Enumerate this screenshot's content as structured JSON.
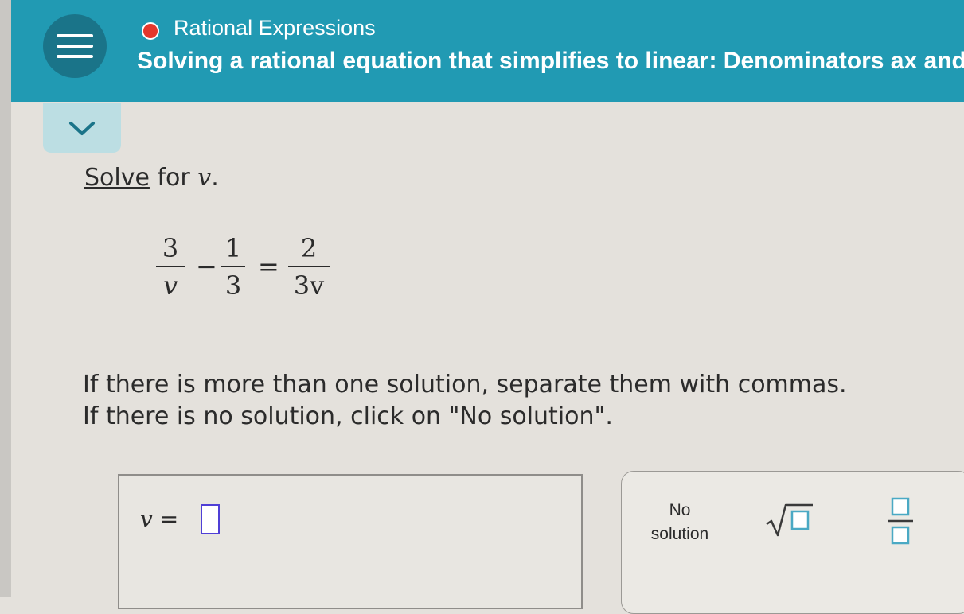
{
  "header": {
    "topic": "Rational Expressions",
    "title": "Solving a rational equation that simplifies to linear: Denominators ax and",
    "menu_icon": "hamburger-icon",
    "status_color": "#e4372c",
    "accent_color": "#219ab3"
  },
  "collapse": {
    "icon": "chevron-down-icon"
  },
  "question": {
    "solve_link": "Solve",
    "solve_rest": " for ",
    "variable": "v",
    "period": "."
  },
  "equation": {
    "term1": {
      "num": "3",
      "den": "v"
    },
    "op1": "−",
    "term2": {
      "num": "1",
      "den": "3"
    },
    "op2": "=",
    "term3": {
      "num": "2",
      "den": "3v"
    }
  },
  "instructions": {
    "line1": "If there is more than one solution, separate them with commas.",
    "line2": "If there is no solution, click on \"No solution\"."
  },
  "answer": {
    "variable": "v",
    "equals": "=",
    "value": ""
  },
  "tools": {
    "no_solution_line1": "No",
    "no_solution_line2": "solution",
    "sqrt_icon": "square-root-icon",
    "fraction_icon": "fraction-icon"
  }
}
